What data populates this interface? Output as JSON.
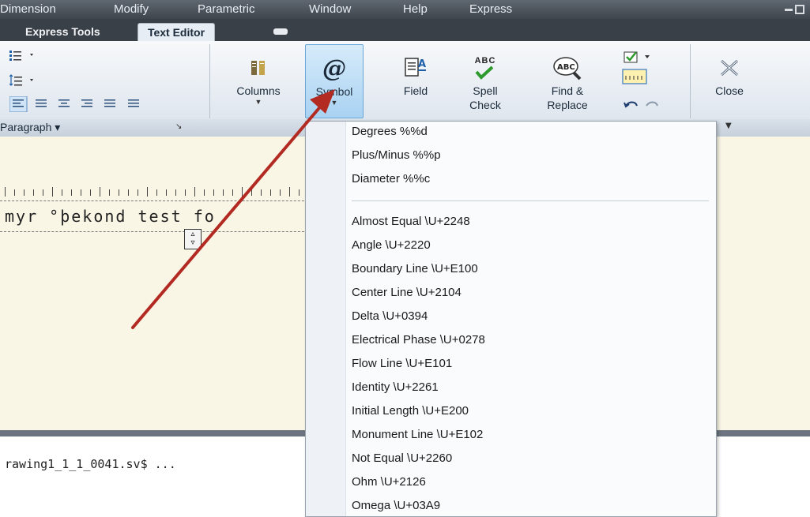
{
  "menubar": {
    "items": [
      "Dimension",
      "Modify",
      "Parametric",
      "Window",
      "Help",
      "Express"
    ]
  },
  "tabs": {
    "express_tools": "Express Tools",
    "text_editor": "Text Editor"
  },
  "ribbon": {
    "columns": "Columns",
    "symbol": "Symbol",
    "field": "Field",
    "spell_check_1": "Spell",
    "spell_check_2": "Check",
    "find_replace_1": "Find &",
    "find_replace_2": "Replace",
    "close": "Close",
    "abc": "ABC",
    "at": "@",
    "paragraph_label": "Paragraph ▾"
  },
  "editor": {
    "text": "myr °þekond test fo"
  },
  "command": {
    "text": "rawing1_1_1_0041.sv$ ..."
  },
  "symbol_menu": {
    "items": [
      "Degrees  %%d",
      "Plus/Minus  %%p",
      "Diameter  %%c",
      "Almost Equal  \\U+2248",
      "Angle  \\U+2220",
      "Boundary Line  \\U+E100",
      "Center Line  \\U+2104",
      "Delta  \\U+0394",
      "Electrical Phase  \\U+0278",
      "Flow Line  \\U+E101",
      "Identity  \\U+2261",
      "Initial Length  \\U+E200",
      "Monument Line  \\U+E102",
      "Not Equal  \\U+2260",
      "Ohm  \\U+2126",
      "Omega  \\U+03A9"
    ]
  },
  "colors": {
    "arrow": "#c0392b",
    "symbol_highlight": "#a9d2f2",
    "editor_bg": "#faf6e6"
  }
}
